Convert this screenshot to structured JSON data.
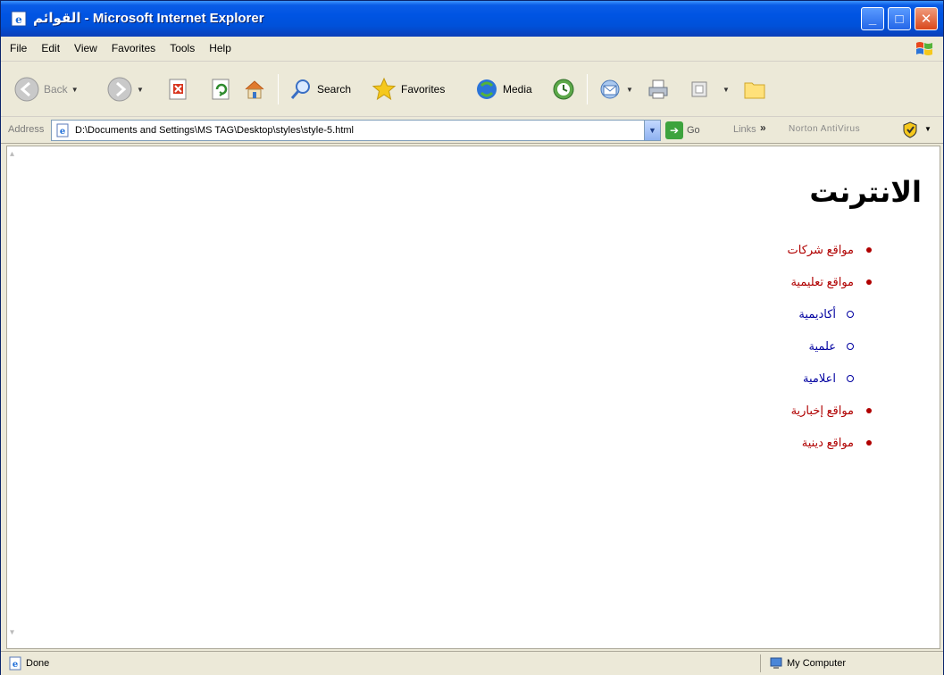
{
  "window": {
    "title": "القوائم - Microsoft Internet Explorer"
  },
  "menu": {
    "items": [
      "File",
      "Edit",
      "View",
      "Favorites",
      "Tools",
      "Help"
    ]
  },
  "toolbar": {
    "back_label": "Back",
    "search_label": "Search",
    "favorites_label": "Favorites",
    "media_label": "Media"
  },
  "address": {
    "label": "Address",
    "url": "D:\\Documents and Settings\\MS TAG\\Desktop\\styles\\style-5.html",
    "go_label": "Go",
    "links_label": "Links",
    "norton_label": "Norton AntiVirus"
  },
  "content": {
    "heading": "الانترنت",
    "items": [
      {
        "label": "مواقع شركات",
        "sub": []
      },
      {
        "label": "مواقع تعليمية",
        "sub": [
          "أكاديمية",
          "علمية",
          "اعلامية"
        ]
      },
      {
        "label": "مواقع إخبارية",
        "sub": []
      },
      {
        "label": "مواقع دينية",
        "sub": []
      }
    ]
  },
  "status": {
    "text": "Done",
    "zone": "My Computer"
  },
  "colors": {
    "list_level1": "#b00000",
    "list_level2": "#0000a0"
  }
}
